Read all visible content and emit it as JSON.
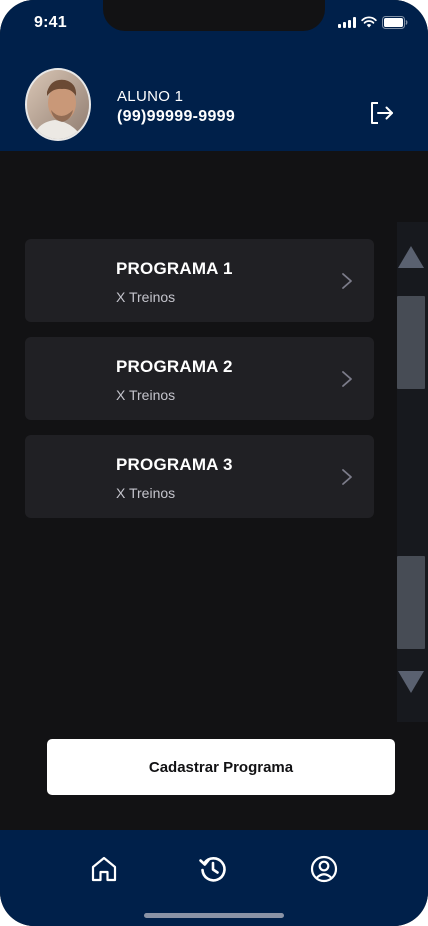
{
  "status_bar": {
    "time": "9:41"
  },
  "header": {
    "user_name": "ALUNO 1",
    "user_phone": "(99)99999-9999"
  },
  "programs": [
    {
      "title": "PROGRAMA 1",
      "subtitle": "X Treinos"
    },
    {
      "title": "PROGRAMA 2",
      "subtitle": "X Treinos"
    },
    {
      "title": "PROGRAMA 3",
      "subtitle": "X Treinos"
    }
  ],
  "actions": {
    "register_program_label": "Cadastrar Programa"
  },
  "tabs": [
    {
      "icon": "home-icon"
    },
    {
      "icon": "history-icon"
    },
    {
      "icon": "profile-icon"
    }
  ],
  "colors": {
    "header_bg": "#00204a",
    "page_bg": "#121214",
    "card_bg": "#202024",
    "button_bg": "#ffffff"
  }
}
